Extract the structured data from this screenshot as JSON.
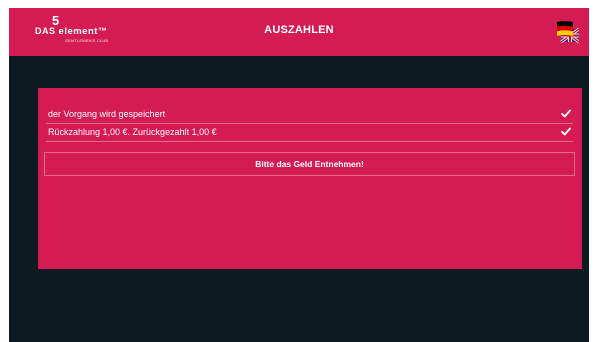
{
  "header": {
    "title": "AUSZAHLEN",
    "logo": {
      "das": "DAS",
      "five": "5",
      "element": "element",
      "tm": "™",
      "subtitle": "GENTLEMEN'S CLUB"
    },
    "language_icon": "german-flag-icon"
  },
  "status": {
    "rows": [
      {
        "text": "der Vorgang wird gespeichert",
        "icon": "check-icon"
      },
      {
        "text": "Rückzahlung 1,00 €. Zurückgezahlt 1,00 €",
        "icon": "check-icon"
      }
    ],
    "message": "Bitte das Geld Entnehmen!"
  },
  "colors": {
    "accent": "#d41b54",
    "background": "#0c1a22",
    "text": "#ffffff"
  }
}
